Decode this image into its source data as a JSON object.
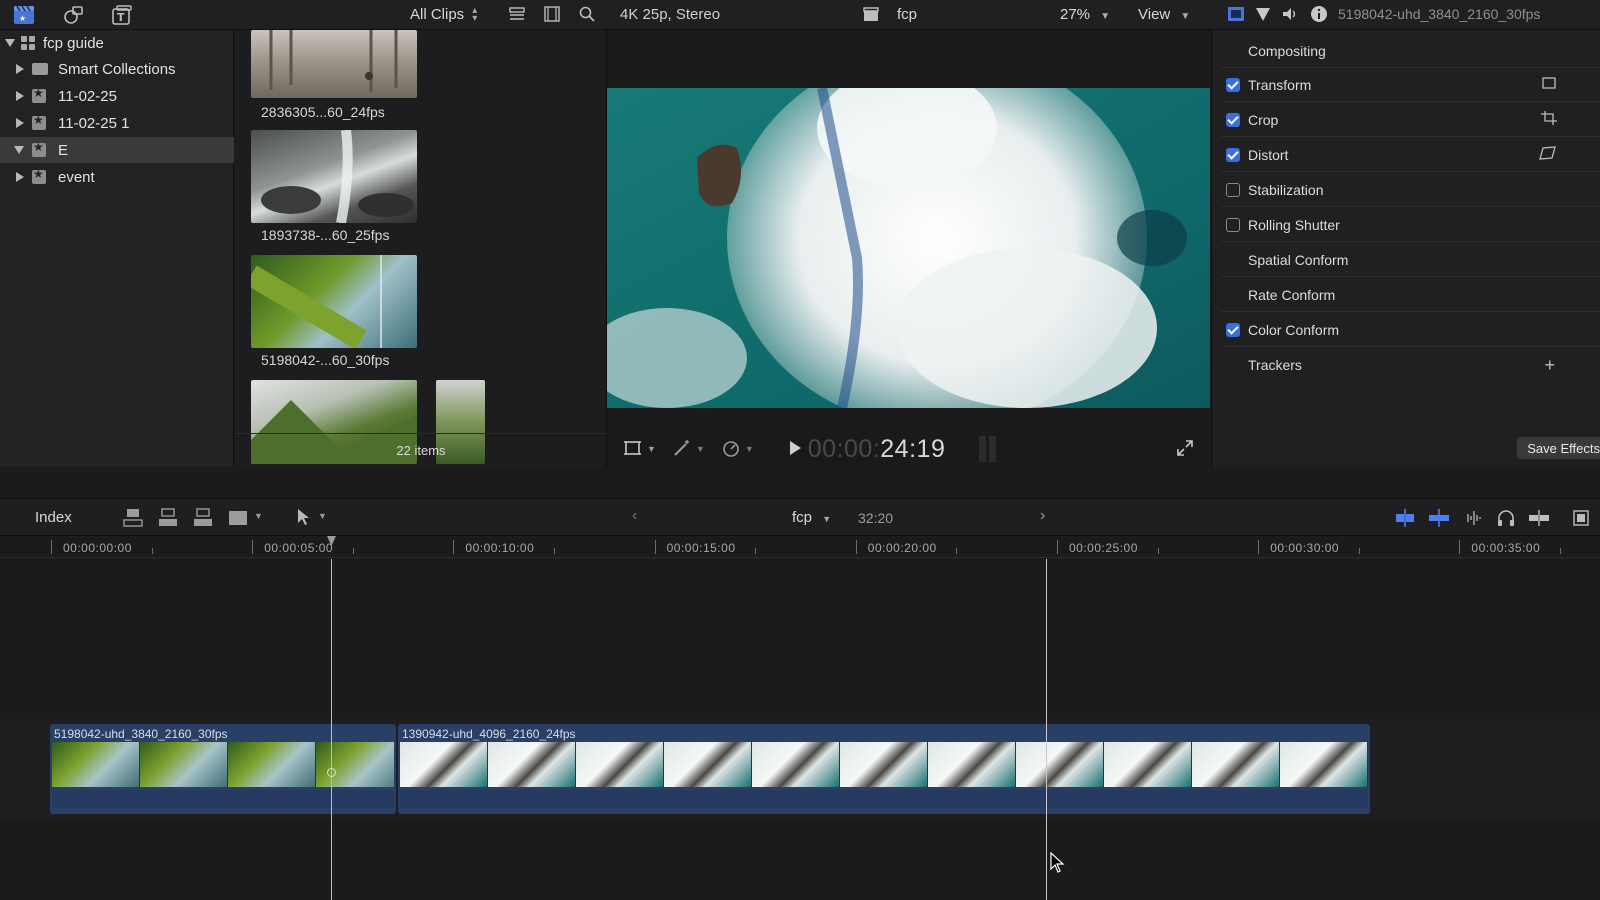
{
  "toolbar": {
    "filter_label": "All Clips",
    "format_label": "4K 25p, Stereo",
    "project_name": "fcp",
    "zoom_label": "27%",
    "view_label": "View",
    "inspected_clip": "5198042-uhd_3840_2160_30fps"
  },
  "libraries": {
    "library_name": "fcp guide",
    "items": [
      {
        "label": "Smart Collections",
        "kind": "folder"
      },
      {
        "label": "11-02-25",
        "kind": "event"
      },
      {
        "label": "11-02-25 1",
        "kind": "event"
      },
      {
        "label": "E",
        "kind": "event",
        "selected": true,
        "expanded": true
      },
      {
        "label": "event",
        "kind": "event"
      }
    ]
  },
  "browser": {
    "clips": [
      {
        "label": "2836305...60_24fps"
      },
      {
        "label": "1893738-...60_25fps"
      },
      {
        "label": "5198042-...60_30fps"
      }
    ],
    "footer": "22 items"
  },
  "viewer": {
    "timecode_dim": "00:00:",
    "timecode_main": "24:19"
  },
  "inspector": {
    "rows": [
      {
        "label": "Compositing",
        "checkbox": "none"
      },
      {
        "label": "Transform",
        "checkbox": "on",
        "icon": "transform-onscreen-icon"
      },
      {
        "label": "Crop",
        "checkbox": "on",
        "icon": "crop-onscreen-icon"
      },
      {
        "label": "Distort",
        "checkbox": "on",
        "icon": "distort-onscreen-icon"
      },
      {
        "label": "Stabilization",
        "checkbox": "off"
      },
      {
        "label": "Rolling Shutter",
        "checkbox": "off"
      },
      {
        "label": "Spatial Conform",
        "checkbox": "none"
      },
      {
        "label": "Rate Conform",
        "checkbox": "none"
      },
      {
        "label": "Color Conform",
        "checkbox": "on"
      },
      {
        "label": "Trackers",
        "checkbox": "none",
        "icon": "add-icon"
      }
    ],
    "save_effects": "Save Effects"
  },
  "timeline": {
    "index_label": "Index",
    "project_name": "fcp",
    "duration": "32:20",
    "ruler": [
      "00:00:00:00",
      "00:00:05:00",
      "00:00:10:00",
      "00:00:15:00",
      "00:00:20:00",
      "00:00:25:00",
      "00:00:30:00",
      "00:00:35:00"
    ],
    "clips": [
      {
        "name": "5198042-uhd_3840_2160_30fps"
      },
      {
        "name": "1390942-uhd_4096_2160_24fps"
      }
    ]
  },
  "colors": {
    "accent": "#3b6fe0",
    "timeline_clip": "#2a3f66",
    "panel_bg": "#202022"
  }
}
